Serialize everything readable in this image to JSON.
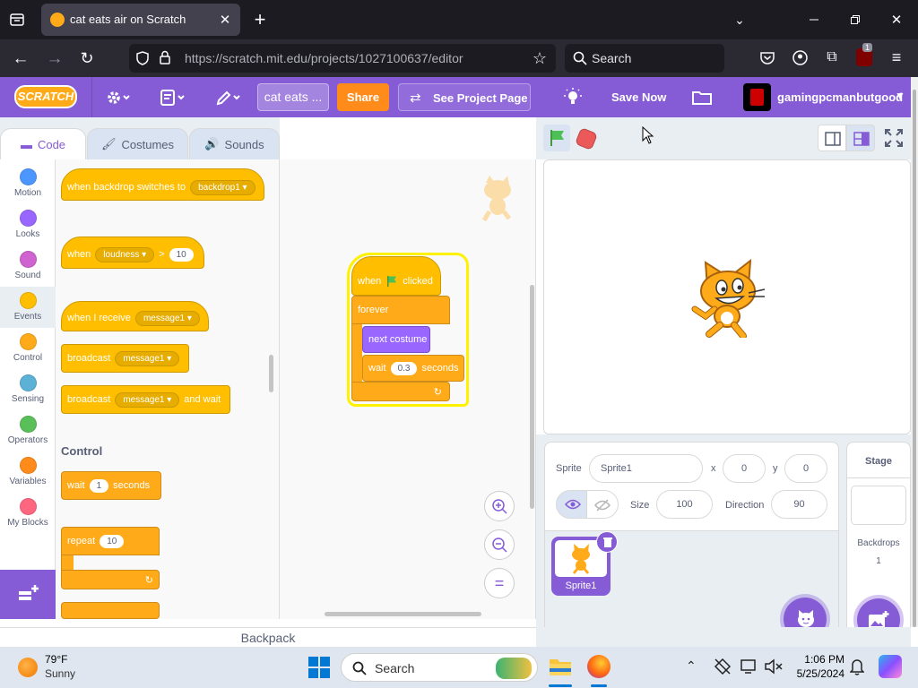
{
  "browser": {
    "tab_title": "cat eats air on Scratch",
    "url": "https://scratch.mit.edu/projects/1027100637/editor",
    "search_placeholder": "Search",
    "extension_badge": "1"
  },
  "scratch_header": {
    "logo": "SCRATCH",
    "project_title": "cat eats ...",
    "share_label": "Share",
    "see_project_page_label": "See Project Page",
    "save_now_label": "Save Now",
    "username": "gamingpcmanbutgood"
  },
  "editor_tabs": [
    "Code",
    "Costumes",
    "Sounds"
  ],
  "categories": [
    {
      "label": "Motion",
      "color": "#4c97ff"
    },
    {
      "label": "Looks",
      "color": "#9966ff"
    },
    {
      "label": "Sound",
      "color": "#cf63cf"
    },
    {
      "label": "Events",
      "color": "#ffbf00"
    },
    {
      "label": "Control",
      "color": "#ffab19"
    },
    {
      "label": "Sensing",
      "color": "#5cb1d6"
    },
    {
      "label": "Operators",
      "color": "#59c059"
    },
    {
      "label": "Variables",
      "color": "#ff8c1a"
    },
    {
      "label": "My Blocks",
      "color": "#ff6680"
    }
  ],
  "palette": {
    "when_backdrop_text": "when backdrop switches to",
    "when_backdrop_value": "backdrop1",
    "when_loudness_text": "when",
    "when_loudness_dropdown": "loudness",
    "when_loudness_op": ">",
    "when_loudness_value": "10",
    "when_receive_text": "when I receive",
    "when_receive_value": "message1",
    "broadcast_text": "broadcast",
    "broadcast_value": "message1",
    "broadcast_wait_text": "broadcast",
    "broadcast_wait_value": "message1",
    "broadcast_wait_suffix": "and wait",
    "control_heading": "Control",
    "wait_text": "wait",
    "wait_value": "1",
    "wait_suffix": "seconds",
    "repeat_text": "repeat",
    "repeat_value": "10"
  },
  "script": {
    "hat_prefix": "when",
    "hat_suffix": "clicked",
    "forever": "forever",
    "next_costume": "next costume",
    "wait_text": "wait",
    "wait_value": "0.3",
    "wait_suffix": "seconds"
  },
  "sprite_info": {
    "sprite_label": "Sprite",
    "sprite_name": "Sprite1",
    "x_label": "x",
    "x_value": "0",
    "y_label": "y",
    "y_value": "0",
    "size_label": "Size",
    "size_value": "100",
    "direction_label": "Direction",
    "direction_value": "90"
  },
  "sprite_list": [
    {
      "name": "Sprite1"
    }
  ],
  "stage_pane": {
    "title": "Stage",
    "backdrops_label": "Backdrops",
    "backdrops_count": "1"
  },
  "backpack_label": "Backpack",
  "taskbar": {
    "weather_temp": "79°F",
    "weather_desc": "Sunny",
    "search_label": "Search",
    "time": "1:06 PM",
    "date": "5/25/2024"
  }
}
